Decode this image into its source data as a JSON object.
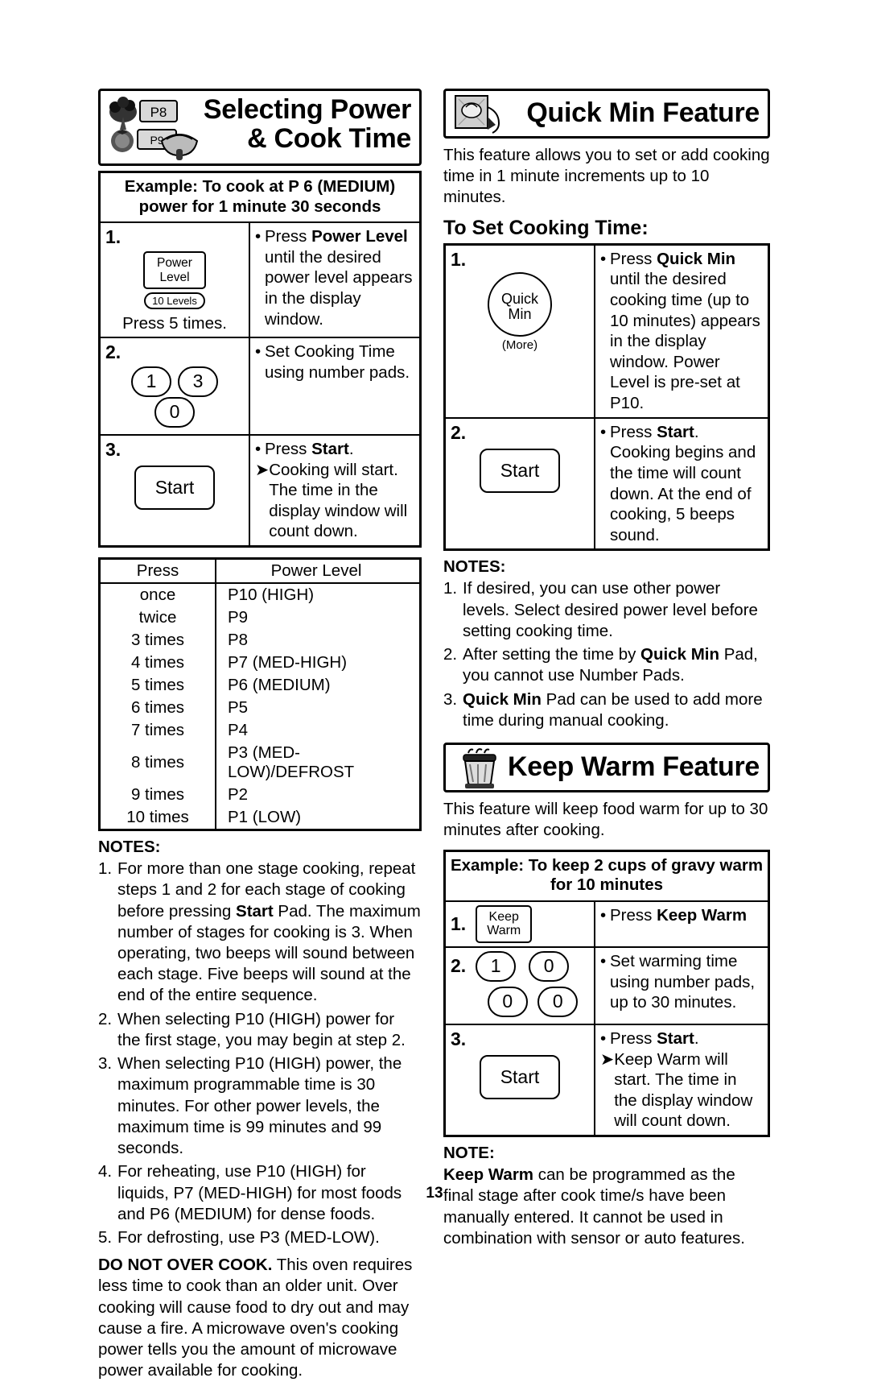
{
  "page": {
    "number": "13"
  },
  "left": {
    "banner_title_line1": "Selecting Power",
    "banner_title_line2": "& Cook Time",
    "banner_icon": "power-cook-illustration",
    "example": {
      "head_line1": "Example: To cook at P 6 (MEDIUM)",
      "head_line2": "power for 1 minute 30 seconds",
      "rows": [
        {
          "num": "1.",
          "button_label_line1": "Power",
          "button_label_line2": "Level",
          "button_sub": "10 Levels",
          "note": "Press 5 times.",
          "text_prefix": "Press ",
          "text_bold": "Power Level",
          "text_rest": " until the desired power level appears in the display window."
        },
        {
          "num": "2.",
          "pads": [
            "1",
            "3",
            "0"
          ],
          "text": "Set Cooking Time using number pads."
        },
        {
          "num": "3.",
          "button_label": "Start",
          "text_prefix": "Press ",
          "text_bold": "Start",
          "text_rest": ".",
          "arrow_text": "Cooking will start. The time in the display window will count down."
        }
      ]
    },
    "power_table": {
      "headers": [
        "Press",
        "Power Level"
      ],
      "rows": [
        [
          "once",
          "P10 (HIGH)"
        ],
        [
          "twice",
          "P9"
        ],
        [
          "3 times",
          "P8"
        ],
        [
          "4 times",
          "P7 (MED-HIGH)"
        ],
        [
          "5 times",
          "P6 (MEDIUM)"
        ],
        [
          "6 times",
          "P5"
        ],
        [
          "7 times",
          "P4"
        ],
        [
          "8 times",
          "P3 (MED-LOW)/DEFROST"
        ],
        [
          "9 times",
          "P2"
        ],
        [
          "10 times",
          "P1 (LOW)"
        ]
      ]
    },
    "notes_title": "NOTES:",
    "notes": [
      {
        "num": "1.",
        "parts": [
          {
            "t": "For more than one stage cooking, repeat steps 1 and 2 for each stage of cooking before pressing "
          },
          {
            "t": "Start",
            "b": true
          },
          {
            "t": " Pad. The maximum number of stages for cooking is 3. When operating, two beeps will sound between each stage. Five beeps will sound at the end of the entire sequence."
          }
        ]
      },
      {
        "num": "2.",
        "parts": [
          {
            "t": "When selecting P10 (HIGH) power for the first stage, you may begin at step 2."
          }
        ]
      },
      {
        "num": "3.",
        "parts": [
          {
            "t": "When selecting P10 (HIGH) power, the maximum programmable time is 30 minutes. For other power levels, the maximum time is 99 minutes and 99 seconds."
          }
        ]
      },
      {
        "num": "4.",
        "parts": [
          {
            "t": "For reheating, use P10 (HIGH) for liquids, P7 (MED-HIGH) for most foods and P6 (MEDIUM) for dense foods."
          }
        ]
      },
      {
        "num": "5.",
        "parts": [
          {
            "t": "For defrosting, use P3 (MED-LOW)."
          }
        ]
      }
    ],
    "warning_bold": "DO NOT OVER COOK.",
    "warning_rest": " This oven requires less time to cook than an older unit. Over cooking will cause food to dry out and may cause a fire. A microwave oven's cooking power tells you the amount of microwave power available for cooking."
  },
  "right": {
    "quick_min": {
      "banner_title": "Quick Min Feature",
      "banner_icon": "quick-min-illustration",
      "intro": "This feature allows you to set or add cooking time in 1 minute increments up to 10 minutes.",
      "subhead": "To Set Cooking Time:",
      "rows": [
        {
          "num": "1.",
          "button_label_line1": "Quick",
          "button_label_line2": "Min",
          "button_sub": "(More)",
          "text_prefix": "Press ",
          "text_bold": "Quick Min",
          "text_rest": " until the desired cooking time (up to 10 minutes) appears in the display window. Power Level is pre-set at P10."
        },
        {
          "num": "2.",
          "button_label": "Start",
          "text_prefix": "Press ",
          "text_bold": "Start",
          "text_rest": ". Cooking begins and the time will count down. At the end of cooking, 5 beeps sound."
        }
      ],
      "notes_title": "NOTES:",
      "notes": [
        {
          "num": "1.",
          "parts": [
            {
              "t": "If desired, you can use other power levels. Select desired power level before setting cooking time."
            }
          ]
        },
        {
          "num": "2.",
          "parts": [
            {
              "t": "After setting the time by "
            },
            {
              "t": "Quick Min",
              "b": true
            },
            {
              "t": " Pad, you cannot use Number Pads."
            }
          ]
        },
        {
          "num": "3.",
          "parts": [
            {
              "t": "Quick Min",
              "b": true
            },
            {
              "t": " Pad can be used to add more time during manual cooking."
            }
          ]
        }
      ]
    },
    "keep_warm": {
      "banner_title": "Keep Warm Feature",
      "banner_icon": "keep-warm-illustration",
      "intro": "This feature will keep food warm for up to 30 minutes after cooking.",
      "example_head_line1": "Example: To keep 2 cups of gravy warm",
      "example_head_line2": "for 10 minutes",
      "rows": [
        {
          "num": "1.",
          "button_label_line1": "Keep",
          "button_label_line2": "Warm",
          "text_prefix": "Press ",
          "text_bold": "Keep Warm",
          "text_rest": ""
        },
        {
          "num": "2.",
          "pads": [
            "1",
            "0",
            "0",
            "0"
          ],
          "text": "Set warming time using number pads, up to 30 minutes."
        },
        {
          "num": "3.",
          "button_label": "Start",
          "text_prefix": "Press ",
          "text_bold": "Start",
          "text_rest": ".",
          "arrow_text": "Keep Warm will start. The time in the display window will count down."
        }
      ],
      "note_title": "NOTE:",
      "note_parts": [
        {
          "t": "Keep Warm",
          "b": true
        },
        {
          "t": " can be programmed as the final stage after cook time/s have been manually entered. It cannot be used in combination with sensor or auto features."
        }
      ]
    }
  }
}
